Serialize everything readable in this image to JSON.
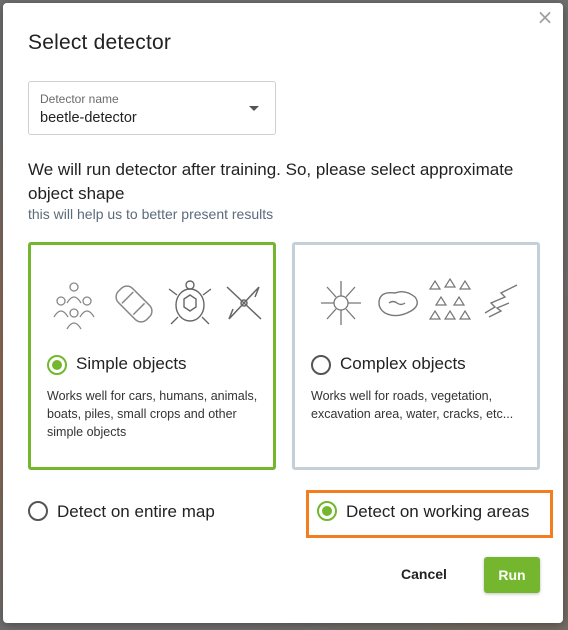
{
  "dialog": {
    "close_glyph": "×",
    "title": "Select detector",
    "detector_select": {
      "label": "Detector name",
      "value": "beetle-detector"
    },
    "intro_text": "We will run detector after training. So, please select approximate object shape",
    "hint_text": "this will help us to better present results",
    "shape_options": [
      {
        "label": "Simple objects",
        "description": "Works well for cars, humans, animals, boats, piles, small crops and other simple objects",
        "selected": true,
        "icons": [
          "people-group-icon",
          "car-icon",
          "turtle-icon",
          "kayak-icon"
        ]
      },
      {
        "label": "Complex objects",
        "description": "Works well for roads, vegetation, excavation area, water, cracks, etc...",
        "selected": false,
        "icons": [
          "road-network-icon",
          "water-pond-icon",
          "trees-icon",
          "cracks-icon"
        ]
      }
    ],
    "area_options": [
      {
        "label": "Detect on entire map",
        "selected": false
      },
      {
        "label": "Detect on working areas",
        "selected": true,
        "highlighted": true
      }
    ],
    "buttons": {
      "cancel": "Cancel",
      "run": "Run"
    },
    "colors": {
      "accent": "#74b72e",
      "highlight": "#f47d20",
      "inactive_border": "#c4cfd8"
    }
  }
}
